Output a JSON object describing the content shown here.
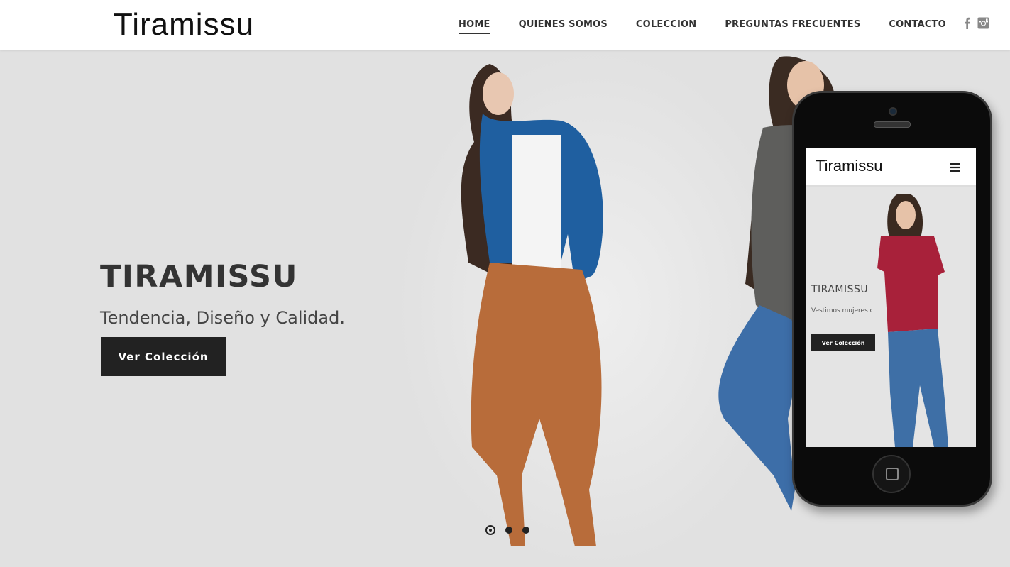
{
  "header": {
    "logo": "Tiramissu",
    "nav": [
      {
        "label": "HOME",
        "active": true
      },
      {
        "label": "QUIENES SOMOS",
        "active": false
      },
      {
        "label": "COLECCION",
        "active": false
      },
      {
        "label": "PREGUNTAS FRECUENTES",
        "active": false
      },
      {
        "label": "CONTACTO",
        "active": false
      }
    ],
    "social_icons": [
      "facebook-icon",
      "instagram-icon"
    ]
  },
  "hero": {
    "title": "TIRAMISSU",
    "subtitle": "Tendencia, Diseño y Calidad.",
    "button_label": "Ver Colección",
    "slides": 3,
    "active_slide": 1
  },
  "phone_mockup": {
    "logo": "Tiramissu",
    "menu_icon": "hamburger-icon",
    "title": "TIRAMISSU",
    "subtitle": "Vestimos mujeres c",
    "button_label": "Ver Colección"
  },
  "colors": {
    "background": "#e1e1e1",
    "button": "#222222",
    "header": "#ffffff",
    "text": "#333333"
  }
}
